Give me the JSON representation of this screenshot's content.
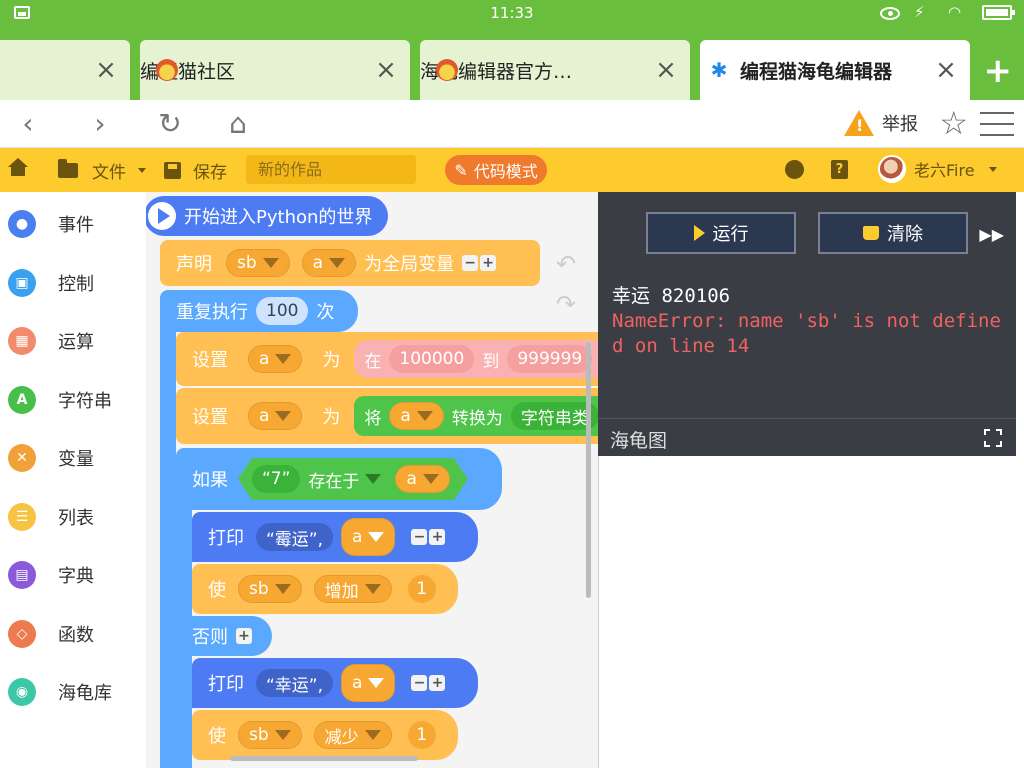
{
  "status": {
    "time": "11:33"
  },
  "tabs": [
    {
      "title": "",
      "active": false
    },
    {
      "title": "编程猫社区",
      "active": false
    },
    {
      "title": "海龟编辑器官方…",
      "active": false
    },
    {
      "title": "编程猫海龟编辑器",
      "active": true
    }
  ],
  "tab_close": "×",
  "tab_add": "+",
  "nav": {
    "back": "‹",
    "forward": "›",
    "reload": "↻",
    "home": "⌂",
    "report": "举报",
    "star": "☆"
  },
  "toolbar": {
    "file": "文件",
    "save": "保存",
    "work_name_placeholder": "新的作品",
    "code_mode": "代码模式",
    "user": "老六Fire"
  },
  "categories": [
    {
      "label": "事件",
      "color": "#4a7ff0",
      "glyph": "●"
    },
    {
      "label": "控制",
      "color": "#3aa0f0",
      "glyph": "▣"
    },
    {
      "label": "运算",
      "color": "#f28a6b",
      "glyph": "▦"
    },
    {
      "label": "字符串",
      "color": "#47c049",
      "glyph": "A"
    },
    {
      "label": "变量",
      "color": "#f0a238",
      "glyph": "✕"
    },
    {
      "label": "列表",
      "color": "#f6c343",
      "glyph": "☰"
    },
    {
      "label": "字典",
      "color": "#8a5ad9",
      "glyph": "▤"
    },
    {
      "label": "函数",
      "color": "#ee7a50",
      "glyph": "◇"
    },
    {
      "label": "海龟库",
      "color": "#3cc7a8",
      "glyph": "◉"
    }
  ],
  "blocks": {
    "start": "开始进入Python的世界",
    "declare": "声明",
    "declare_scope": "sb",
    "declare_var": "a",
    "global_var": "为全局变量",
    "repeat": "重复执行",
    "repeat_count": "100",
    "repeat_unit": "次",
    "set1": "设置",
    "set1_var": "a",
    "set1_as": "为",
    "in": "在",
    "rand_from": "100000",
    "to": "到",
    "rand_to": "999999",
    "set2": "设置",
    "set2_var": "a",
    "set2_as": "为",
    "convert_will": "将",
    "convert_var": "a",
    "convert_to": "转换为",
    "convert_type": "字符串类",
    "if": "如果",
    "if_str": "“7”",
    "exists_in": "存在于",
    "if_var": "a",
    "print1": "打印",
    "print1_str": "“霉运”,",
    "print1_var": "a",
    "use1": "使",
    "use1_var": "sb",
    "use1_op": "增加",
    "use1_num": "1",
    "else": "否则",
    "print2": "打印",
    "print2_str": "“幸运”,",
    "print2_var": "a",
    "use2": "使",
    "use2_var": "sb",
    "use2_op": "减少",
    "use2_num": "1"
  },
  "output": {
    "run": "运行",
    "clear": "清除",
    "line_ok": "幸运 820106",
    "line_err": "NameError: name 'sb' is not defined on line 14",
    "turtle_title": "海龟图"
  }
}
